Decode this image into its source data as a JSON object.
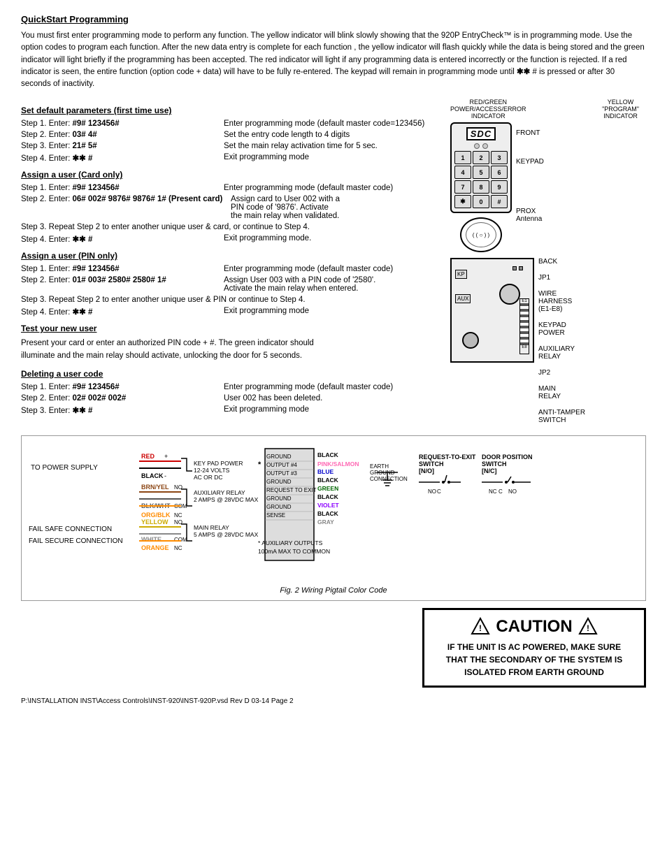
{
  "page": {
    "title": "QuickStart  Programming",
    "intro": "You must first enter programming mode to perform any function. The yellow indicator will blink slowly showing that the  920P EntryCheck™ is in programming mode. Use the option codes to program each function.   After the new data entry is complete for each function , the yellow indicator will flash quickly while the data is being stored and the green indicator will light briefly if the programming has been accepted.  The red indicator will light if any programming data is entered incorrectly or the function is rejected. If a red indicator is seen, the entire function (option code + data)  will have to be fully re-entered.  The keypad will remain in programming mode until ✱✱ # is pressed or after 30 seconds of inactivity.",
    "indicator_labels": {
      "red_green": "RED/GREEN\nPOWER/ACCESS/ERROR\nINDICATOR",
      "yellow": "YELLOW\n\"PROGRAM\"\nINDICATOR"
    },
    "sections": {
      "default_params": {
        "title": "Set default parameters (first time use)",
        "steps": [
          {
            "label": "Step 1. Enter:  #9#  123456#",
            "desc": "Enter programming mode (default master code=123456)"
          },
          {
            "label": "Step 2. Enter:  03#  4#",
            "desc": "Set the entry code length to 4 digits"
          },
          {
            "label": "Step 3. Enter:  21#  5#",
            "desc": "Set the main relay activation time for 5 sec."
          },
          {
            "label": "Step 4. Enter:  ✱✱ #",
            "desc": "Exit programming mode"
          }
        ]
      },
      "assign_card": {
        "title": "Assign a user  (Card only)",
        "steps": [
          {
            "label": "Step 1. Enter:  #9#  123456#",
            "desc": "Enter programming mode (default master code)"
          },
          {
            "label": "Step 2. Enter:  06#  002# 9876# 9876# 1# (Present card)",
            "desc": "Assign card to User 002 with a PIN code of '9876'. Activate the main relay when validated."
          },
          {
            "label": "Step 3. Repeat Step 2 to enter another unique user & card, or continue to Step 4.",
            "desc": ""
          },
          {
            "label": "Step 4. Enter:  ✱✱  #",
            "desc": "Exit programming mode."
          }
        ]
      },
      "assign_pin": {
        "title": "Assign a user  (PIN only)",
        "steps": [
          {
            "label": "Step 1. Enter:  #9#  123456#",
            "desc": "Enter programming mode (default master code)"
          },
          {
            "label": "Step 2. Enter:  01#  003# 2580# 2580# 1#",
            "desc": "Assign User 003 with a PIN code of '2580'. Activate the main relay when entered."
          },
          {
            "label": "Step 3. Repeat Step 2 to enter another unique user & PIN or continue to Step 4.",
            "desc": ""
          },
          {
            "label": "Step 4. Enter:  ✱✱  #",
            "desc": "Exit programming mode"
          }
        ]
      },
      "test_user": {
        "title": "Test your new user",
        "body": "Present your card or enter an authorized PIN code + #. The green indicator should illuminate and the main relay should activate, unlocking  the door for 5 seconds."
      },
      "delete_user": {
        "title": "Deleting a  user code",
        "steps": [
          {
            "label": "Step 1. Enter:  #9#  123456#",
            "desc": "Enter programming mode (default master code)"
          },
          {
            "label": "Step 2. Enter:  02#  002# 002#",
            "desc": "User 002 has been deleted."
          },
          {
            "label": "Step 3. Enter:  ✱✱ #",
            "desc": "Exit programming mode"
          }
        ]
      }
    },
    "diagram": {
      "keys": [
        "1",
        "2",
        "3",
        "4",
        "5",
        "6",
        "7",
        "8",
        "9",
        "✱",
        "0",
        "#"
      ],
      "front_label": "FRONT",
      "keypad_label": "KEYPAD",
      "prox_label": "PROX\nAntenna",
      "back_label": "BACK",
      "jp1_label": "JP1",
      "wire_harness_label": "WIRE\nHARNESS\n(E1-E8)",
      "e1_label": "E1",
      "e8_label": "E8",
      "keypad_power_label": "KEYPAD\nPOWER",
      "auxiliary_relay_label": "AUXILIARY\nRELAY",
      "jp2_label": "JP2",
      "main_relay_label": "MAIN\nRELAY",
      "anti_tamper_label": "ANTI-TAMPER\nSWITCH"
    },
    "wiring": {
      "fig_caption": "Fig. 2 Wiring Pigtail Color Code",
      "to_power": "TO POWER SUPPLY",
      "fail_safe": "FAIL SAFE CONNECTION",
      "fail_secure": "FAIL SECURE CONNECTION",
      "keypad_power_label": "KEY PAD POWER\n12-24 VOLTS\nAC OR DC",
      "aux_relay_label": "AUXILIARY RELAY\n2 AMPS @ 28VDC MAX",
      "main_relay_label": "MAIN RELAY\n5 AMPS @ 28VDC MAX",
      "wires_left": [
        {
          "color": "RED",
          "css": "#cc0000",
          "polarity": "+"
        },
        {
          "color": "BLACK",
          "css": "#000",
          "polarity": "-"
        },
        {
          "color": "BRN/YEL",
          "css": "#8B4513",
          "terminal": "NO"
        },
        {
          "color": "BLK/WHT",
          "css": "#555",
          "terminal": "COM"
        },
        {
          "color": "ORG/BLK",
          "css": "#FF8C00",
          "terminal": "NC"
        },
        {
          "color": "YELLOW",
          "css": "#ccaa00",
          "terminal": "NO"
        },
        {
          "color": "WHITE",
          "css": "#888",
          "terminal": "COM"
        },
        {
          "color": "ORANGE",
          "css": "#FF8C00",
          "terminal": "NC"
        }
      ],
      "rte_label": "REQUEST-TO-EXIT\nSWITCH\n[N/O]",
      "door_pos_label": "DOOR POSITION\nSWITCH\n[N/C]",
      "aux_outputs_note": "* AUXILIARY OUTPUTS\n100mA MAX TO COMMON",
      "right_wires": {
        "ground_e": "GROUND",
        "output4": "OUTPUT #4",
        "output3": "OUTPUT #3",
        "ground2": "GROUND",
        "request_to_exit": "REQUEST TO EXIT",
        "ground3": "GROUND",
        "ground4": "GROUND",
        "sense": "SENSE",
        "colors": [
          "BLACK",
          "PINK/SALMON",
          "BLUE",
          "BLACK",
          "GREEN",
          "BLACK",
          "VIOLET",
          "BLACK",
          "GRAY"
        ],
        "earth_ground": "EARTH\nGROUND\nCONNECTION"
      }
    },
    "caution": {
      "title": "CAUTION",
      "text": "IF THE UNIT IS AC POWERED, MAKE SURE\nTHAT THE SECONDARY OF THE SYSTEM IS\nISOLATED FROM EARTH GROUND"
    },
    "footer": "P:\\INSTALLATION INST\\Access Controls\\INST-920\\INST-920P.vsd    Rev D   03-14   Page 2"
  }
}
